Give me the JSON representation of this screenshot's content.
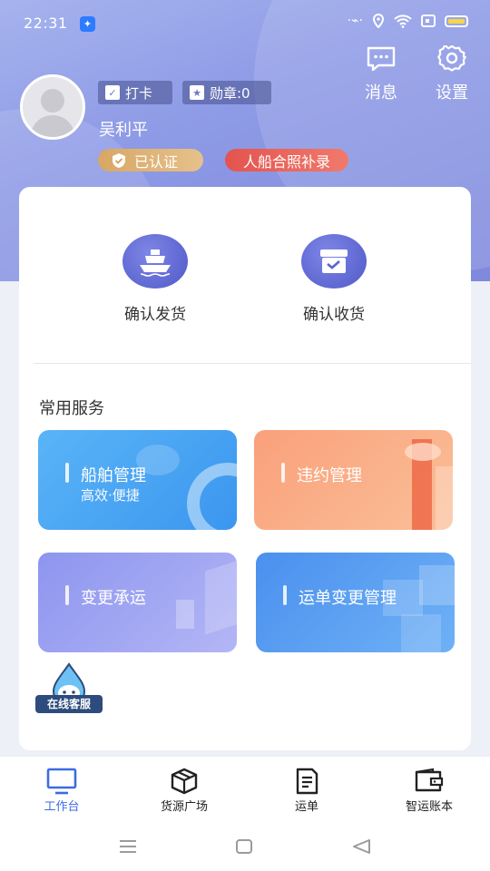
{
  "status_bar": {
    "time": "22:31"
  },
  "header": {
    "messages_label": "消息",
    "settings_label": "设置",
    "checkin_label": "打卡",
    "medal_label": "勋章:0",
    "username": "吴利平",
    "verified_label": "已认证",
    "record_label": "人船合照补录"
  },
  "quick_actions": {
    "confirm_ship_label": "确认发货",
    "confirm_receive_label": "确认收货"
  },
  "services": {
    "section_title": "常用服务",
    "ship_mgmt_title": "船舶管理",
    "ship_mgmt_subtitle": "高效·便捷",
    "breach_mgmt_title": "违约管理",
    "change_carrier_title": "变更承运",
    "waybill_change_title": "运单变更管理"
  },
  "customer_service": {
    "label": "在线客服"
  },
  "tabbar": {
    "workbench": "工作台",
    "cargo_square": "货源广场",
    "waybill": "运单",
    "account": "智运账本"
  },
  "colors": {
    "accent": "#3d6be3",
    "hero": "#8e9be6",
    "verified": "#d8a765",
    "record": "#e4534f"
  }
}
